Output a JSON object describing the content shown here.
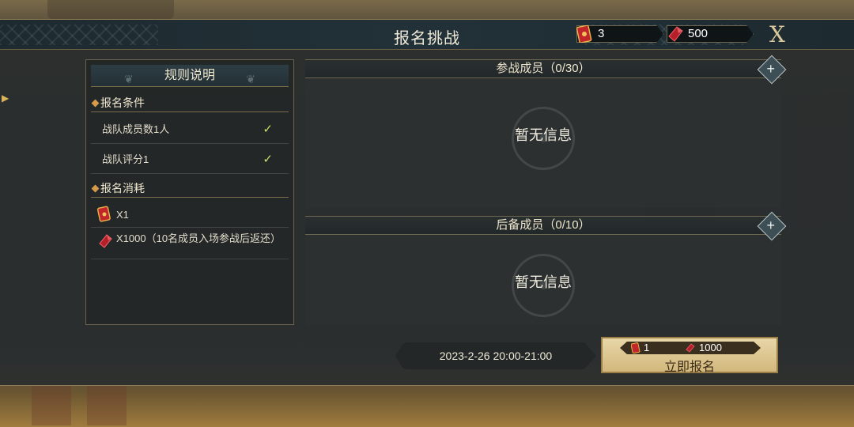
{
  "header": {
    "title": "报名挑战",
    "ticket_count": "3",
    "gem_count": "500",
    "close_label": "X"
  },
  "rules": {
    "title": "规则说明",
    "conditions_title": "报名条件",
    "conditions": [
      {
        "text": "战队成员数1人",
        "met": true
      },
      {
        "text": "战队评分1",
        "met": true
      }
    ],
    "cost_title": "报名消耗",
    "costs": [
      {
        "icon": "ticket-icon",
        "text": "X1"
      },
      {
        "icon": "gem-icon",
        "text": "X1000（10名成员入场参战后返还）"
      }
    ]
  },
  "participants": {
    "title": "参战成员（0/30）",
    "empty_text": "暂无信息"
  },
  "reserves": {
    "title": "后备成员（0/10）",
    "empty_text": "暂无信息"
  },
  "footer": {
    "time": "2023-2-26  20:00-21:00",
    "cost_ticket": "1",
    "cost_gem": "1000",
    "signup_label": "立即报名"
  },
  "colors": {
    "accent_gold": "#d2b87c",
    "check_green": "#c8e06a",
    "gem_red": "#b3202a",
    "ticket_red": "#c0262a"
  }
}
